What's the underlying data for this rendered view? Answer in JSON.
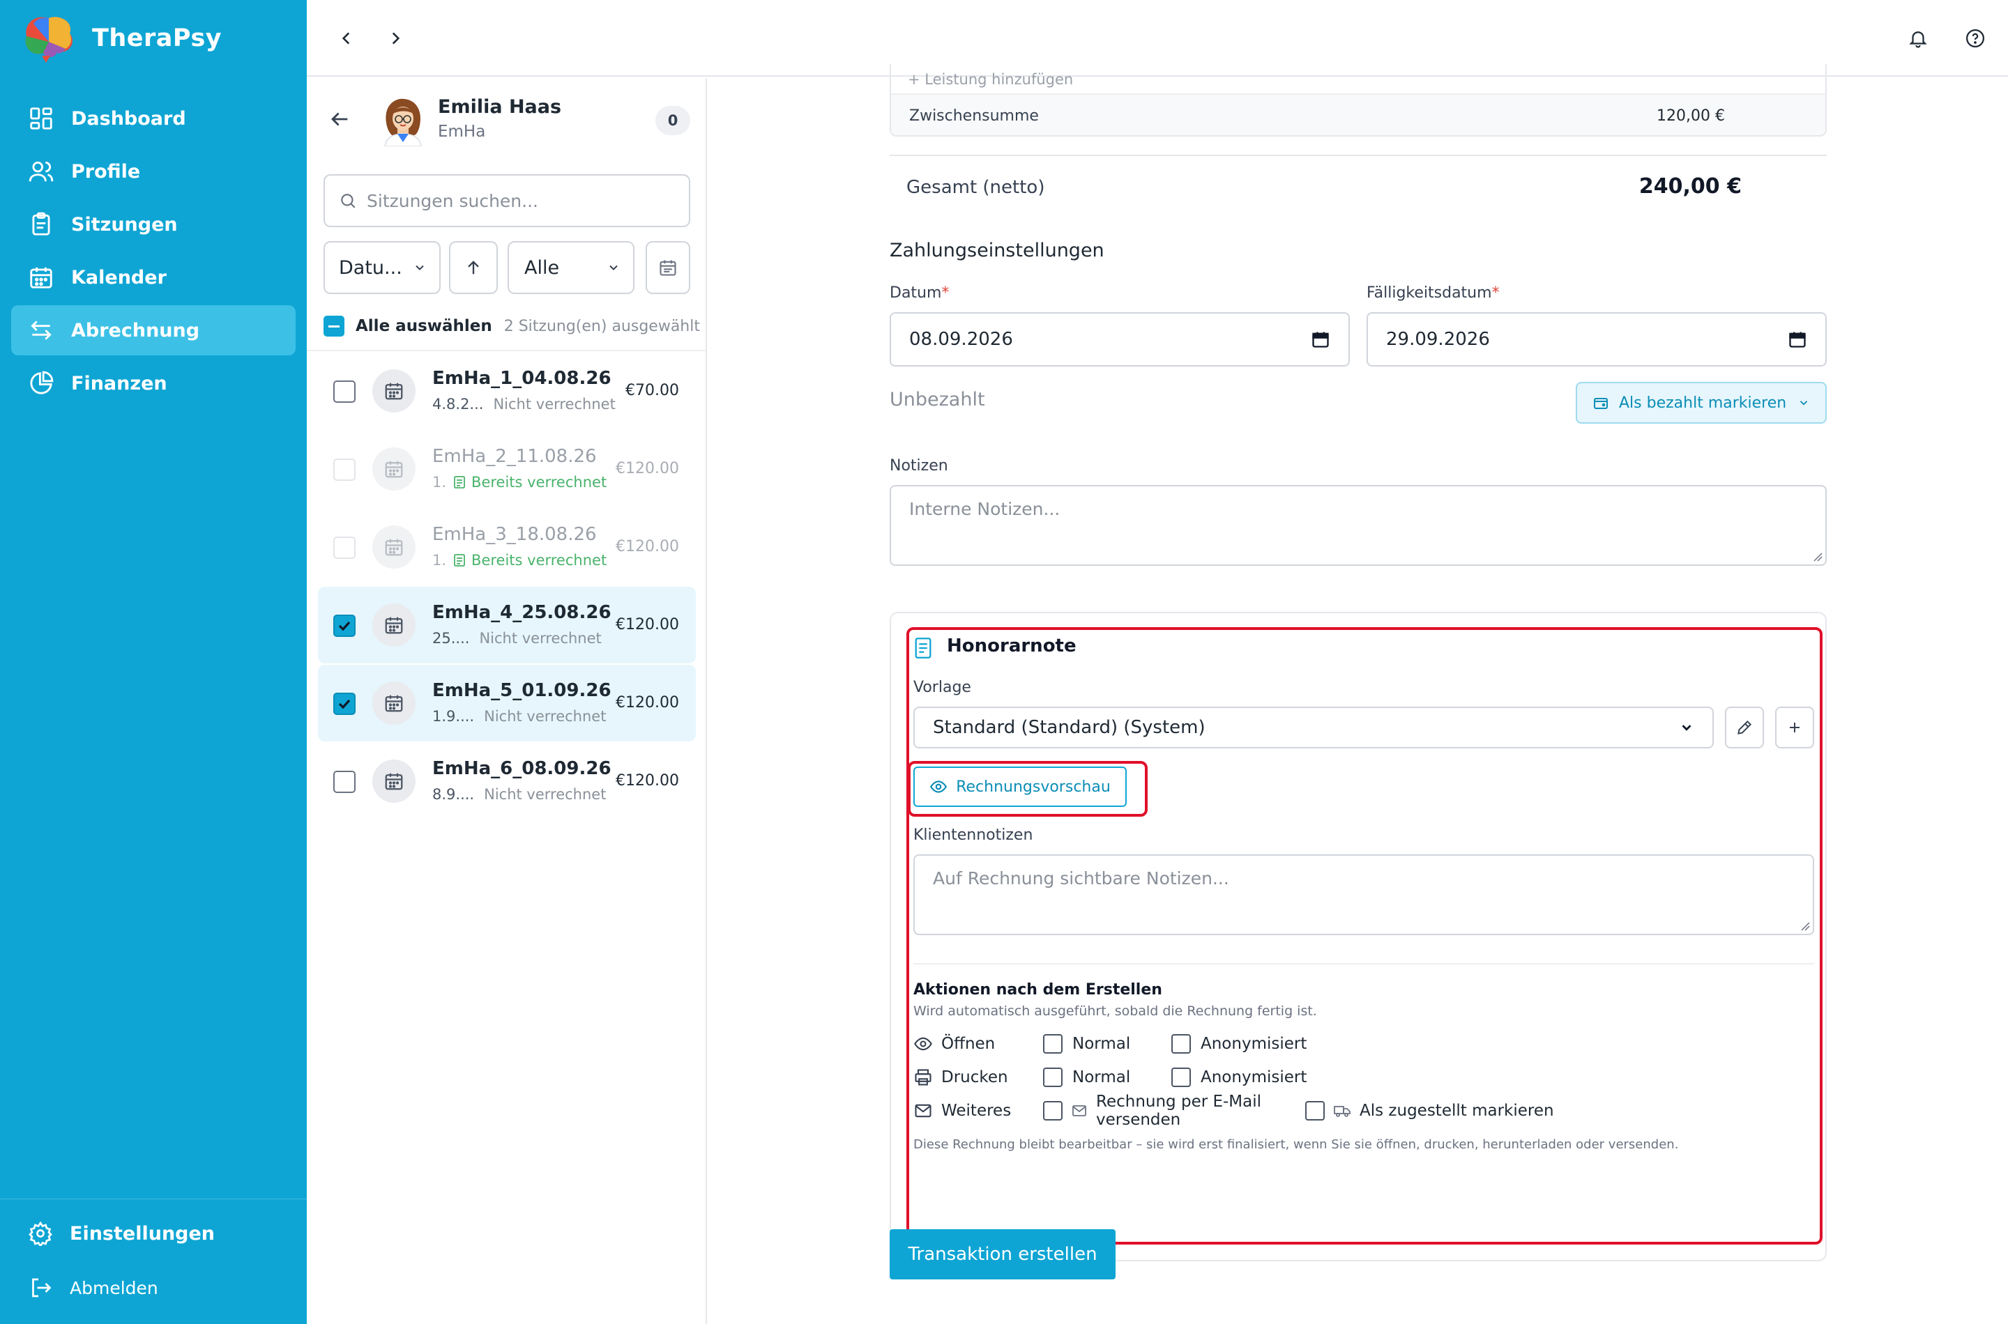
{
  "app": {
    "name": "TheraPsy"
  },
  "sidebar": {
    "items": [
      {
        "label": "Dashboard",
        "icon": "dashboard-icon"
      },
      {
        "label": "Profile",
        "icon": "users-icon"
      },
      {
        "label": "Sitzungen",
        "icon": "clipboard-icon"
      },
      {
        "label": "Kalender",
        "icon": "calendar-icon"
      },
      {
        "label": "Abrechnung",
        "icon": "exchange-icon",
        "active": true
      },
      {
        "label": "Finanzen",
        "icon": "pie-chart-icon"
      }
    ],
    "settings_label": "Einstellungen",
    "logout_label": "Abmelden"
  },
  "client": {
    "name": "Emilia Haas",
    "short": "EmHa",
    "badge": "0"
  },
  "search": {
    "placeholder": "Sitzungen suchen..."
  },
  "filters": {
    "sort_label": "Datu...",
    "status_label": "Alle"
  },
  "selection": {
    "select_all_label": "Alle auswählen",
    "selected_count": "2 Sitzung(en) ausgewählt"
  },
  "sessions": [
    {
      "title": "EmHa_1_04.08.26",
      "date": "4.8.2...",
      "status": "Nicht verrechnet",
      "price": "€70.00",
      "state": "unchecked"
    },
    {
      "title": "EmHa_2_11.08.26",
      "date": "1.",
      "status": "Bereits verrechnet",
      "price": "€120.00",
      "state": "disabled"
    },
    {
      "title": "EmHa_3_18.08.26",
      "date": "1.",
      "status": "Bereits verrechnet",
      "price": "€120.00",
      "state": "disabled"
    },
    {
      "title": "EmHa_4_25.08.26",
      "date": "25....",
      "status": "Nicht verrechnet",
      "price": "€120.00",
      "state": "checked"
    },
    {
      "title": "EmHa_5_01.09.26",
      "date": "1.9....",
      "status": "Nicht verrechnet",
      "price": "€120.00",
      "state": "checked"
    },
    {
      "title": "EmHa_6_08.09.26",
      "date": "8.9....",
      "status": "Nicht verrechnet",
      "price": "€120.00",
      "state": "unchecked"
    }
  ],
  "summary": {
    "add_service_label": "Leistung hinzufügen",
    "subtotal_label": "Zwischensumme",
    "subtotal_value": "120,00 €",
    "total_label": "Gesamt (netto)",
    "total_value": "240,00 €"
  },
  "payment": {
    "section_title": "Zahlungseinstellungen",
    "date_label": "Datum",
    "date_value": "08.09.2026",
    "due_label": "Fälligkeitsdatum",
    "due_value": "29.09.2026",
    "status_text": "Unbezahlt",
    "mark_paid_label": "Als bezahlt markieren",
    "notes_label": "Notizen",
    "notes_placeholder": "Interne Notizen..."
  },
  "invoice": {
    "title": "Honorarnote",
    "template_label": "Vorlage",
    "template_value": "Standard (Standard) (System)",
    "preview_label": "Rechnungsvorschau",
    "client_notes_label": "Klientennotizen",
    "client_notes_placeholder": "Auf Rechnung sichtbare Notizen...",
    "actions_title": "Aktionen nach dem Erstellen",
    "actions_subtitle": "Wird automatisch ausgeführt, sobald die Rechnung fertig ist.",
    "open_label": "Öffnen",
    "print_label": "Drucken",
    "more_label": "Weiteres",
    "normal_label": "Normal",
    "anon_label": "Anonymisiert",
    "email_label": "Rechnung per E-Mail versenden",
    "delivered_label": "Als zugestellt markieren",
    "footnote": "Diese Rechnung bleibt bearbeitbar – sie wird erst finalisiert, wenn Sie sie öffnen, drucken, herunterladen oder versenden."
  },
  "submit_label": "Transaktion erstellen",
  "colors": {
    "brand": "#0ea5d4",
    "highlight": "#e0102a",
    "success": "#49b36b"
  }
}
